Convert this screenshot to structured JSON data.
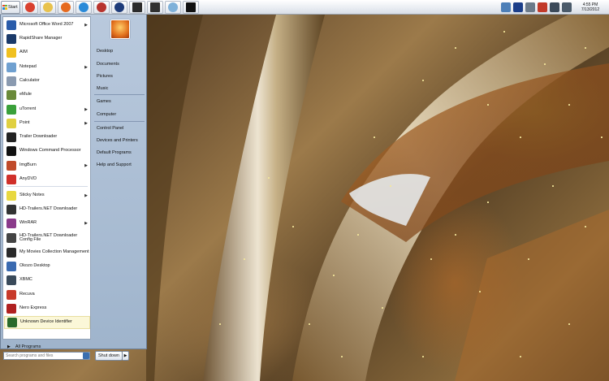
{
  "taskbar": {
    "start_label": "Start",
    "pinned": [
      {
        "icon": "chrome-icon",
        "color": "#d9412f"
      },
      {
        "icon": "explorer-folder-icon",
        "color": "#e8c24c"
      },
      {
        "icon": "firefox-icon",
        "color": "#e66a1f"
      },
      {
        "icon": "internet-explorer-icon",
        "color": "#2a8ad8"
      },
      {
        "icon": "calendar-icon",
        "color": "#b8332d"
      },
      {
        "icon": "usb-drive-icon",
        "color": "#1e3c7a"
      },
      {
        "icon": "media-center-icon",
        "color": "#2b2b2b"
      },
      {
        "icon": "eye-icon",
        "color": "#303030"
      },
      {
        "icon": "paint-icon",
        "color": "#7fb1d9"
      },
      {
        "icon": "command-prompt-icon",
        "color": "#111111"
      }
    ],
    "tray": [
      {
        "icon": "network-drive-icon",
        "color": "#4d7fb8"
      },
      {
        "icon": "bluray-icon",
        "color": "#1b3e8a"
      },
      {
        "icon": "device-icon",
        "color": "#6b7a8a"
      },
      {
        "icon": "warning-flag-icon",
        "color": "#c23a2a"
      },
      {
        "icon": "speaker-icon",
        "color": "#3c4a5a"
      },
      {
        "icon": "display-icon",
        "color": "#4a5a6a"
      }
    ],
    "time": "4:55 PM",
    "date": "7/13/2012"
  },
  "start_menu": {
    "programs": [
      {
        "label": "Microsoft Office Word 2007",
        "icon": "word-icon",
        "color": "#2a5caa",
        "submenu": true
      },
      {
        "label": "RapidShare Manager",
        "icon": "rapidshare-icon",
        "color": "#1a3a6a",
        "submenu": false
      },
      {
        "label": "AIM",
        "icon": "aim-icon",
        "color": "#f0c020",
        "submenu": false
      },
      {
        "label": "Notepad",
        "icon": "notepad-icon",
        "color": "#6fa0d0",
        "submenu": true
      },
      {
        "label": "Calculator",
        "icon": "calculator-icon",
        "color": "#8a9ab0",
        "submenu": false
      },
      {
        "label": "eMule",
        "icon": "emule-icon",
        "color": "#6a8a3a",
        "submenu": false
      },
      {
        "label": "uTorrent",
        "icon": "utorrent-icon",
        "color": "#3aa03a",
        "submenu": true
      },
      {
        "label": "Point",
        "icon": "point-icon",
        "color": "#e0d040",
        "submenu": true
      },
      {
        "label": "Trailer Downloader",
        "icon": "trailer-downloader-icon",
        "color": "#222222",
        "submenu": false
      },
      {
        "label": "Windows Command Processor",
        "icon": "cmd-icon",
        "color": "#111111",
        "submenu": false
      },
      {
        "label": "ImgBurn",
        "icon": "imgburn-icon",
        "color": "#c04a2a",
        "submenu": true
      },
      {
        "label": "AnyDVD",
        "icon": "anydvd-icon",
        "color": "#d0302a",
        "submenu": false
      },
      {
        "label": "Sticky Notes",
        "icon": "sticky-notes-icon",
        "color": "#e8d840",
        "submenu": true
      },
      {
        "label": "HD-Trailers.NET Downloader",
        "icon": "hd-trailers-icon",
        "color": "#333333",
        "submenu": false
      },
      {
        "label": "WinRAR",
        "icon": "winrar-icon",
        "color": "#8a3a8a",
        "submenu": true
      },
      {
        "label": "HD-Trailers.NET Downloader Config File",
        "icon": "config-file-icon",
        "color": "#444444",
        "submenu": false
      },
      {
        "label": "My Movies Collection Management",
        "icon": "my-movies-icon",
        "color": "#2a2a2a",
        "submenu": false
      },
      {
        "label": "Okozo Desktop",
        "icon": "okozo-icon",
        "color": "#3a6ab0",
        "submenu": false
      },
      {
        "label": "XBMC",
        "icon": "xbmc-icon",
        "color": "#3a4a5a",
        "submenu": false
      },
      {
        "label": "Recuva",
        "icon": "recuva-icon",
        "color": "#c83a2a",
        "submenu": false
      },
      {
        "label": "Nero Express",
        "icon": "nero-icon",
        "color": "#b02020",
        "submenu": false
      },
      {
        "label": "Unknown Device Identifier",
        "icon": "device-identifier-icon",
        "color": "#2a6a2a",
        "submenu": false
      }
    ],
    "all_programs": "All Programs",
    "search_placeholder": "Search programs and files",
    "right_links": [
      "Desktop",
      "Documents",
      "Pictures",
      "Music",
      "Games",
      "Computer",
      "Control Panel",
      "Devices and Printers",
      "Default Programs",
      "Help and Support"
    ],
    "shutdown_label": "Shut down"
  }
}
